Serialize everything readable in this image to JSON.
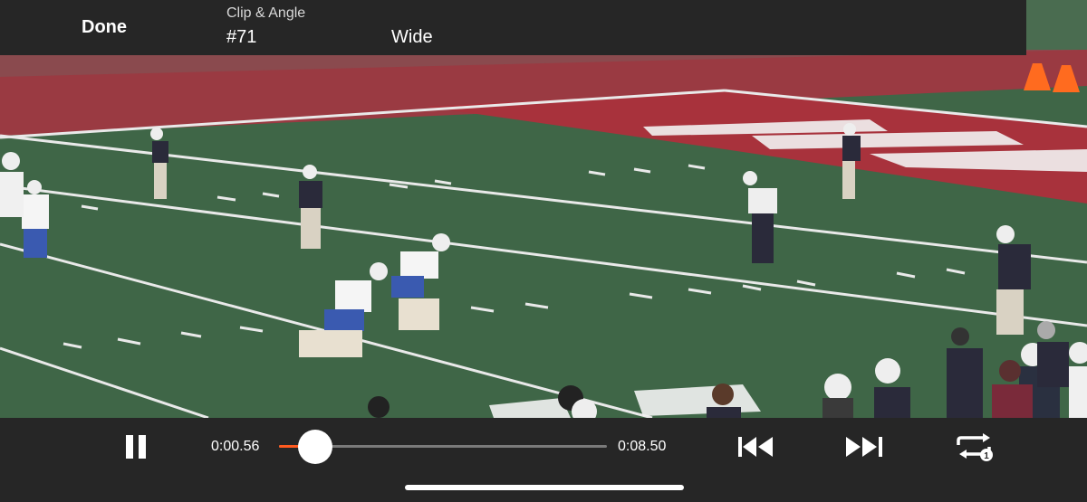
{
  "header": {
    "done_label": "Done",
    "clip_angle_label": "Clip & Angle",
    "clip_value": "#71",
    "angle_value": "Wide"
  },
  "player": {
    "current_time": "0:00.56",
    "duration": "0:08.50",
    "progress_fraction": 0.066,
    "state": "playing"
  },
  "icons": {
    "pause": "pause-icon",
    "skip_back": "skip-back-icon",
    "skip_forward": "skip-forward-icon",
    "loop": "loop-once-icon"
  },
  "colors": {
    "bar_background": "#262626",
    "progress_accent": "#ff5a1f",
    "field_green": "#3f6647",
    "endzone_red": "#a8323c"
  },
  "video": {
    "description_hidden": "football practice frame"
  }
}
